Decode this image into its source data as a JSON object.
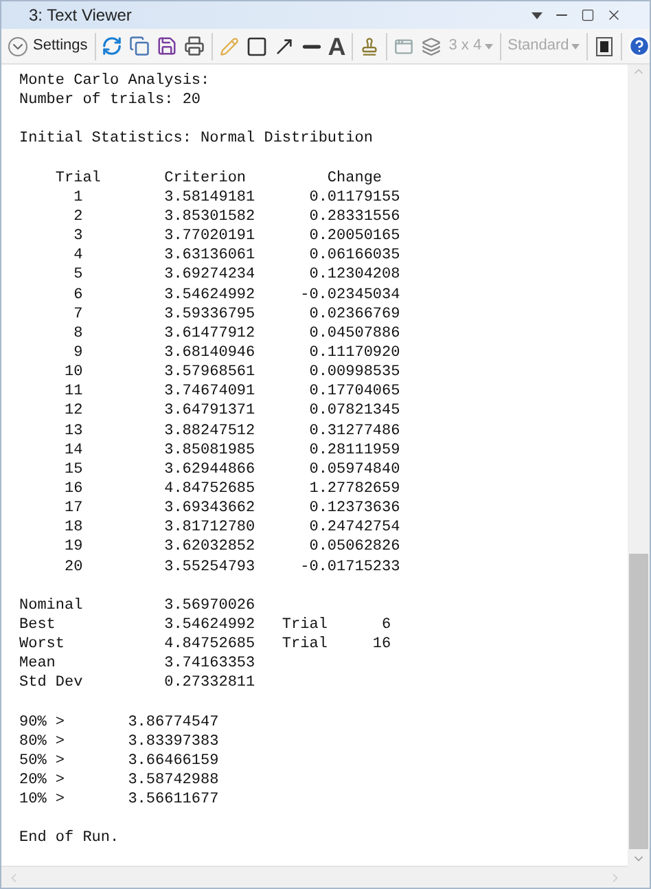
{
  "window": {
    "title": "3: Text Viewer"
  },
  "toolbar": {
    "settings_label": "Settings",
    "text_tool_glyph": "A",
    "dropdowns": [
      {
        "label": "3 x 4",
        "disabled": true
      },
      {
        "label": "Standard",
        "disabled": true
      }
    ]
  },
  "report": {
    "header_lines": [
      "Monte Carlo Analysis:",
      "Number of trials: 20"
    ],
    "subtitle": "Initial Statistics: Normal Distribution",
    "columns": [
      "Trial",
      "Criterion",
      "Change"
    ],
    "rows": [
      [
        "1",
        "3.58149181",
        "0.01179155"
      ],
      [
        "2",
        "3.85301582",
        "0.28331556"
      ],
      [
        "3",
        "3.77020191",
        "0.20050165"
      ],
      [
        "4",
        "3.63136061",
        "0.06166035"
      ],
      [
        "5",
        "3.69274234",
        "0.12304208"
      ],
      [
        "6",
        "3.54624992",
        "-0.02345034"
      ],
      [
        "7",
        "3.59336795",
        "0.02366769"
      ],
      [
        "8",
        "3.61477912",
        "0.04507886"
      ],
      [
        "9",
        "3.68140946",
        "0.11170920"
      ],
      [
        "10",
        "3.57968561",
        "0.00998535"
      ],
      [
        "11",
        "3.74674091",
        "0.17704065"
      ],
      [
        "12",
        "3.64791371",
        "0.07821345"
      ],
      [
        "13",
        "3.88247512",
        "0.31277486"
      ],
      [
        "14",
        "3.85081985",
        "0.28111959"
      ],
      [
        "15",
        "3.62944866",
        "0.05974840"
      ],
      [
        "16",
        "4.84752685",
        "1.27782659"
      ],
      [
        "17",
        "3.69343662",
        "0.12373636"
      ],
      [
        "18",
        "3.81712780",
        "0.24742754"
      ],
      [
        "19",
        "3.62032852",
        "0.05062826"
      ],
      [
        "20",
        "3.55254793",
        "-0.01715233"
      ]
    ],
    "summary": [
      {
        "label": "Nominal",
        "value": "3.56970026"
      },
      {
        "label": "Best",
        "value": "3.54624992",
        "trial_label": "Trial",
        "trial": "6"
      },
      {
        "label": "Worst",
        "value": "4.84752685",
        "trial_label": "Trial",
        "trial": "16"
      },
      {
        "label": "Mean",
        "value": "3.74163353"
      },
      {
        "label": "Std Dev",
        "value": "0.27332811"
      }
    ],
    "percentiles": [
      {
        "label": "90% >",
        "value": "3.86774547"
      },
      {
        "label": "80% >",
        "value": "3.83397383"
      },
      {
        "label": "50% >",
        "value": "3.66466159"
      },
      {
        "label": "20% >",
        "value": "3.58742988"
      },
      {
        "label": "10% >",
        "value": "3.56611677"
      }
    ],
    "footer": "End of Run."
  }
}
